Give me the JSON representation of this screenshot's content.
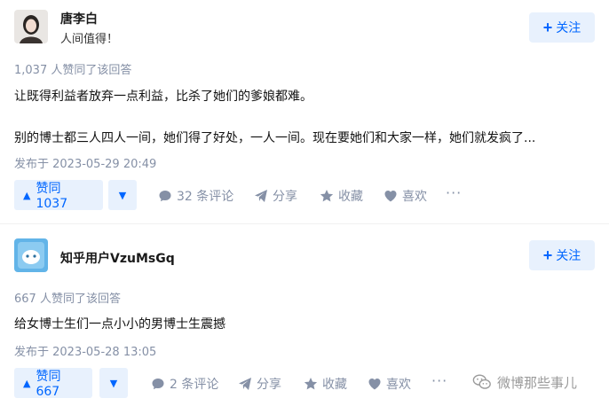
{
  "answers": [
    {
      "author": {
        "name": "唐李白",
        "bio": "人间值得！"
      },
      "follow_label": "关注",
      "vote_summary": "1,037 人赞同了该回答",
      "content": [
        "让既得利益者放弃一点利益，比杀了她们的爹娘都难。",
        "别的博士都三人四人一间，她们得了好处，一人一间。现在要她们和大家一样，她们就发疯了..."
      ],
      "publish_time": "发布于 2023-05-29 20:49",
      "upvote_label": "赞同 1037",
      "comments_label": "32 条评论",
      "share_label": "分享",
      "collect_label": "收藏",
      "like_label": "喜欢",
      "more_label": "···"
    },
    {
      "author": {
        "name": "知乎用户VzuMsGq"
      },
      "follow_label": "关注",
      "vote_summary": "667 人赞同了该回答",
      "content": [
        "给女博士生们一点小小的男博士生震撼"
      ],
      "publish_time": "发布于 2023-05-28 13:05",
      "upvote_label": "赞同 667",
      "comments_label": "2 条评论",
      "share_label": "分享",
      "collect_label": "收藏",
      "like_label": "喜欢",
      "more_label": "···"
    }
  ],
  "watermark": "微博那些事儿",
  "icons": {
    "upvote": "triangle-up-icon",
    "downvote": "triangle-down-icon",
    "comment": "comment-bubble-icon",
    "share": "paper-plane-icon",
    "collect": "star-icon",
    "like": "heart-icon",
    "more": "more-dots-icon",
    "watermark": "wechat-logo-icon"
  },
  "colors": {
    "accent": "#0066ff",
    "accent_bg": "#e8f1fd",
    "meta": "#8590a6"
  }
}
